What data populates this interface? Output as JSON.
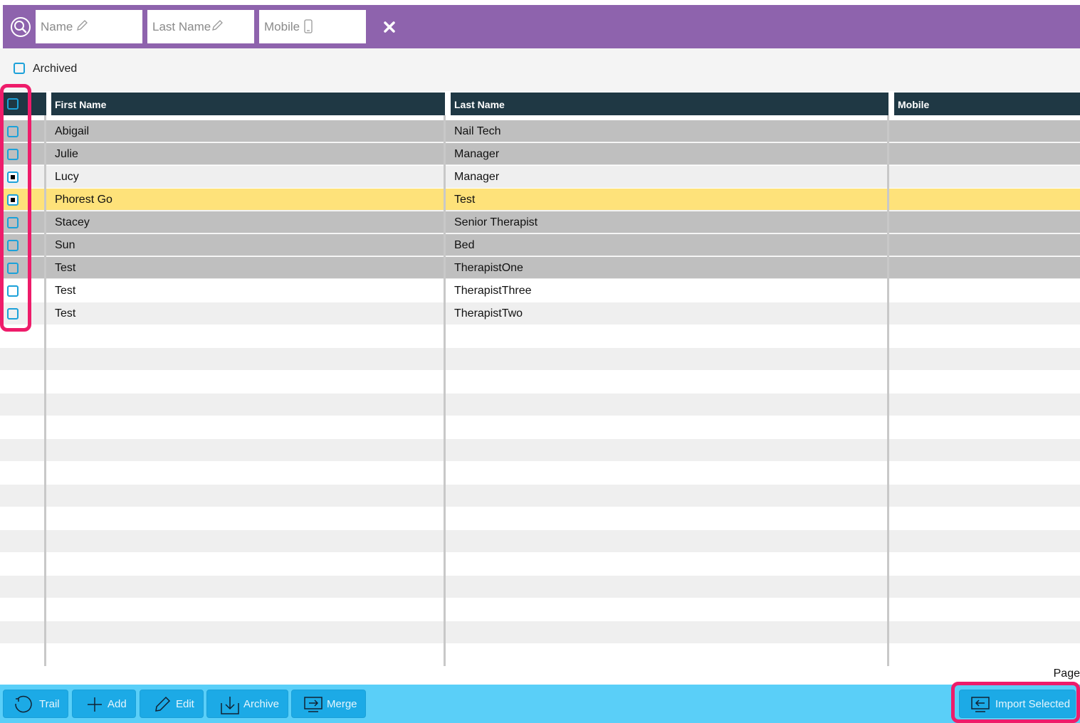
{
  "search": {
    "name_placeholder": "Name",
    "last_name_placeholder": "Last Name",
    "mobile_placeholder": "Mobile"
  },
  "filter": {
    "archived_label": "Archived",
    "archived_checked": false
  },
  "table": {
    "columns": [
      "First Name",
      "Last Name",
      "Mobile"
    ],
    "rows": [
      {
        "first": "Abigail",
        "last": "Nail Tech",
        "mobile": "",
        "checked": false,
        "style": "gray"
      },
      {
        "first": "Julie",
        "last": "Manager",
        "mobile": "",
        "checked": false,
        "style": "gray"
      },
      {
        "first": "Lucy",
        "last": "Manager",
        "mobile": "",
        "checked": true,
        "style": "light"
      },
      {
        "first": "Phorest Go",
        "last": "Test",
        "mobile": "",
        "checked": true,
        "style": "selected"
      },
      {
        "first": "Stacey",
        "last": "Senior Therapist",
        "mobile": "",
        "checked": false,
        "style": "gray"
      },
      {
        "first": "Sun",
        "last": "Bed",
        "mobile": "",
        "checked": false,
        "style": "gray"
      },
      {
        "first": "Test",
        "last": "TherapistOne",
        "mobile": "",
        "checked": false,
        "style": "gray"
      },
      {
        "first": "Test",
        "last": "TherapistThree",
        "mobile": "",
        "checked": false,
        "style": "white"
      },
      {
        "first": "Test",
        "last": "TherapistTwo",
        "mobile": "",
        "checked": false,
        "style": "light"
      }
    ]
  },
  "pager": {
    "label": "Page"
  },
  "toolbar": {
    "trail": "Trail",
    "add": "Add",
    "edit": "Edit",
    "archive": "Archive",
    "merge": "Merge",
    "import_selected": "Import Selected"
  },
  "colors": {
    "header_bar": "#8e63ad",
    "table_header": "#1f3844",
    "row_gray": "#bfbfbf",
    "row_light": "#efefef",
    "row_selected": "#fee27a",
    "toolbar_bg": "#5acff8",
    "button_bg": "#1caae6",
    "highlight": "#ee1c6a"
  },
  "icons": [
    "search-icon",
    "pencil-icon",
    "phone-icon",
    "close-icon",
    "undo-icon",
    "plus-icon",
    "pencil-icon",
    "archive-icon",
    "merge-icon",
    "import-icon"
  ]
}
